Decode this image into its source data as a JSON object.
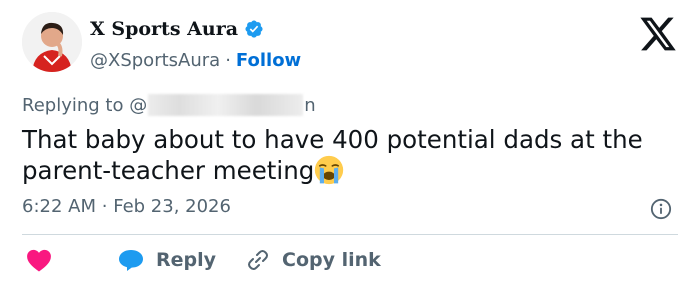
{
  "author": {
    "display_name": "X Sports Aura",
    "handle": "@XSportsAura",
    "separator": "·",
    "follow_label": "Follow",
    "verified": true
  },
  "reply": {
    "prefix": "Replying to @",
    "suffix": "n"
  },
  "tweet": {
    "text": "That baby about to have 400 potential dads at the parent-teacher meeting",
    "emoji": "loudly-crying-face-emoji"
  },
  "meta": {
    "time": "6:22 AM",
    "separator": "·",
    "date": "Feb 23, 2026"
  },
  "actions": {
    "reply_label": "Reply",
    "copy_link_label": "Copy link"
  },
  "icons": [
    "verified-badge-icon",
    "x-logo-icon",
    "info-icon",
    "heart-icon",
    "reply-bubble-icon",
    "link-icon"
  ],
  "colors": {
    "verified": "#1d9bf0",
    "follow": "#006fd6",
    "heart": "#f91880",
    "reply_bubble": "#1d9bf0",
    "secondary_text": "#536471"
  }
}
